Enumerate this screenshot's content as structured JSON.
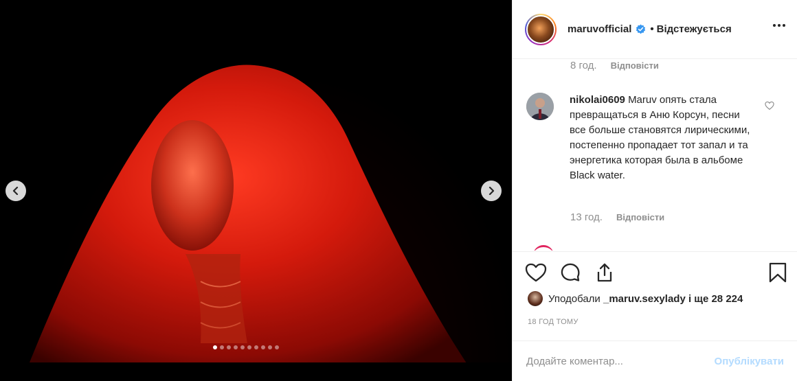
{
  "media": {
    "prev_icon": "chevron-left-icon",
    "next_icon": "chevron-right-icon",
    "slide_count": 10,
    "active_slide": 1
  },
  "header": {
    "username": "maruvofficial",
    "separator": "•",
    "follow_status": "Відстежується",
    "verified_icon": "verified-badge-icon",
    "more_icon": "more-options-icon"
  },
  "comments": {
    "top_time": "8 год.",
    "top_reply": "Відповісти",
    "items": [
      {
        "username": "nikolai0609",
        "text": "Maruv опять стала превращаться в Аню Корсун, песни все больше становятся лирическими, постепенно пропадает тот запал и та энергетика которая была в альбоме Black water.",
        "time": "13 год.",
        "reply": "Відповісти"
      }
    ]
  },
  "actions": {
    "like_icon": "heart-icon",
    "comment_icon": "comment-icon",
    "share_icon": "share-icon",
    "save_icon": "bookmark-icon"
  },
  "likes": {
    "prefix": "Уподобали",
    "user": "_maruv.sexylady",
    "suffix": "і ще 28 224"
  },
  "timeago": "18 ГОД ТОМУ",
  "composer": {
    "placeholder": "Додайте коментар...",
    "publish_label": "Опублікувати"
  },
  "colors": {
    "accent_disabled": "#b3dbff",
    "muted": "#8e8e8e",
    "text": "#262626",
    "verified": "#3897f0"
  }
}
